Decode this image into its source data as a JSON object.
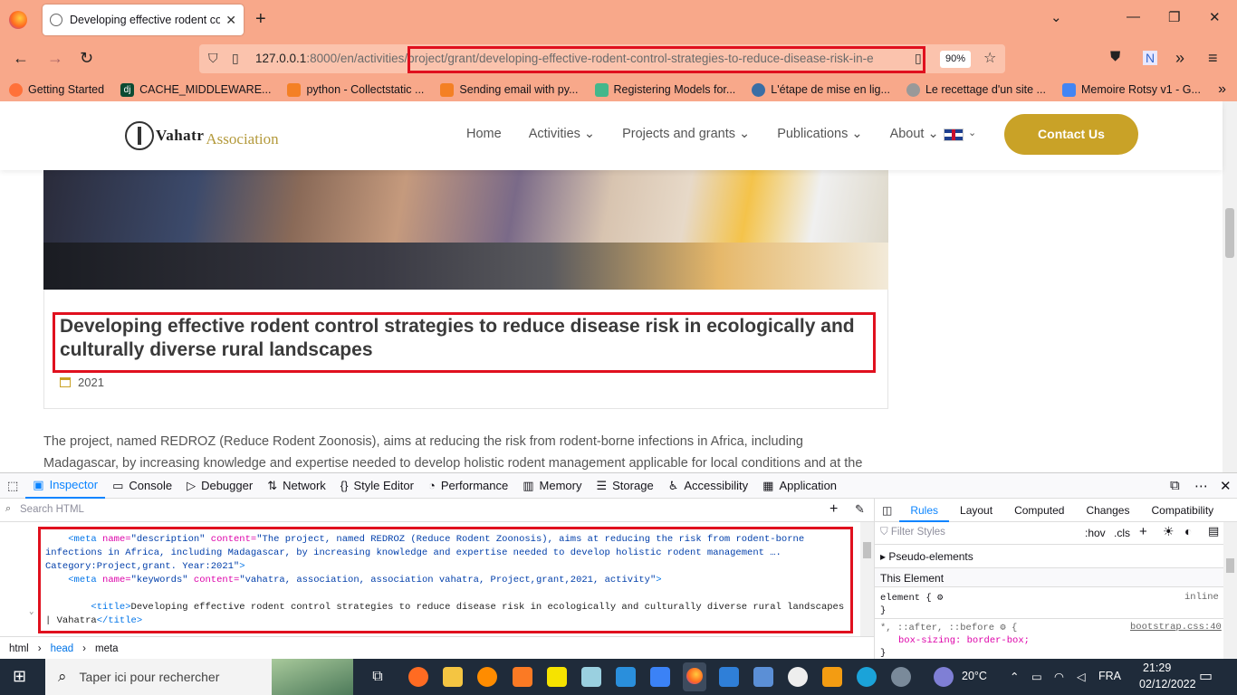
{
  "browser": {
    "tab_title": "Developing effective rodent cor",
    "url_host": "127.0.0.1",
    "url_rest": ":8000/en/activities",
    "url_path": "project/grant/developing-effective-rodent-control-strategies-to-reduce-disease-risk-in-e",
    "zoom": "90%",
    "bookmarks": [
      "Getting Started",
      "CACHE_MIDDLEWARE...",
      "python - Collectstatic ...",
      "Sending email with py...",
      "Registering Models for...",
      "L'étape de mise en lig...",
      "Le recettage d'un site ...",
      "Memoire Rotsy v1 - G..."
    ]
  },
  "site": {
    "logo_part1": "Vahatr",
    "logo_part2": "Association",
    "menu": [
      "Home",
      "Activities ⌄",
      "Projects and grants ⌄",
      "Publications ⌄",
      "About ⌄"
    ],
    "contact": "Contact Us",
    "title": "Developing effective rodent control strategies to reduce disease risk in ecologically and culturally diverse rural landscapes",
    "year": "2021",
    "paragraph": "The project, named REDROZ (Reduce Rodent Zoonosis), aims at reducing the risk from rodent-borne infections in Africa, including Madagascar, by increasing knowledge and expertise needed to develop holistic rodent management applicable for local conditions and at the community"
  },
  "devtools": {
    "tabs": [
      "Inspector",
      "Console",
      "Debugger",
      "Network",
      "Style Editor",
      "Performance",
      "Memory",
      "Storage",
      "Accessibility",
      "Application"
    ],
    "search_placeholder": "Search HTML",
    "code_line1_tag": "<meta",
    "code_desc_attr": "name=",
    "code_desc_name": "\"description\"",
    "code_content_attr": "content=",
    "code_desc_value": "\"The project, named REDROZ (Reduce Rodent Zoonosis), aims at reducing the risk from rodent-borne infections in Africa, including Madagascar, by increasing knowledge and expertise needed to develop holistic rodent management …. Category:Project,grant. Year:2021\"",
    "code_kw_name": "\"keywords\"",
    "code_kw_value": "\"vahatra, association, association vahatra, Project,grant,2021, activity\"",
    "code_title_open": "<title>",
    "code_title_text": "Developing effective rodent control strategies to reduce disease risk in ecologically and culturally diverse rural landscapes | Vahatra",
    "code_title_close": "</title>",
    "breadcrumbs": [
      "html",
      "head",
      "meta"
    ],
    "rules_tabs": [
      "Rules",
      "Layout",
      "Computed",
      "Changes",
      "Compatibility"
    ],
    "filter_placeholder": "Filter Styles",
    "hov": ":hov",
    "cls": ".cls",
    "pseudo": "Pseudo-elements",
    "this_element": "This Element",
    "element_rule": "element {",
    "inline": "inline",
    "close_brace": "}",
    "universal_selector": "*, ::after, ::before",
    "bootstrap_src": "bootstrap.css:40",
    "box_sizing": "box-sizing: border-box;"
  },
  "taskbar": {
    "search": "Taper ici pour rechercher",
    "temp": "20°C",
    "lang": "FRA",
    "time": "21:29",
    "date": "02/12/2022"
  }
}
